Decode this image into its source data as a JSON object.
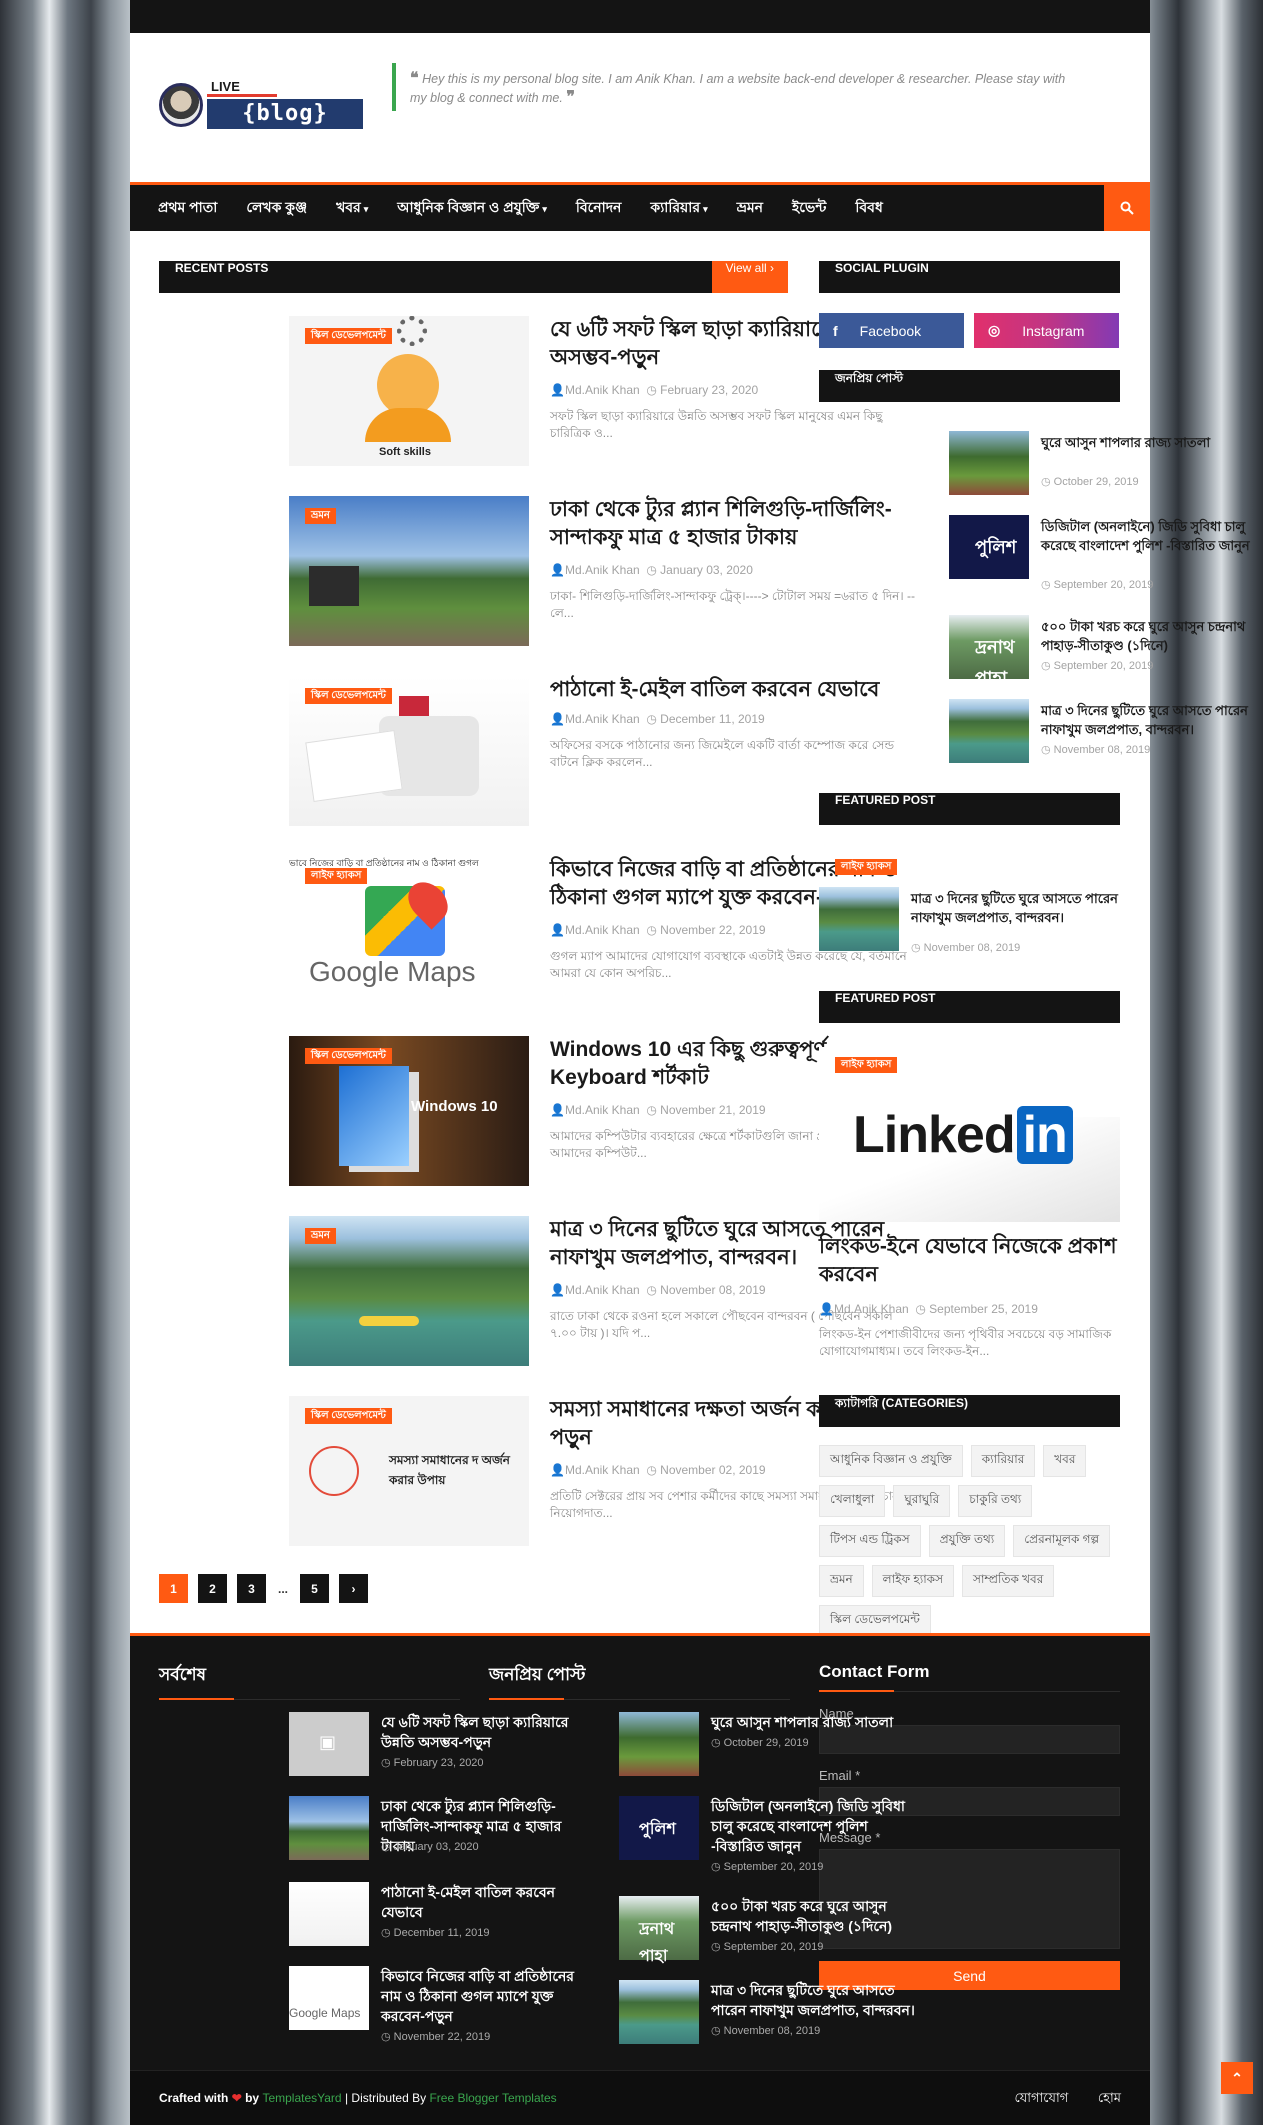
{
  "header": {
    "logo_live": "LIVE",
    "logo_blog": "{blog}",
    "quote": "Hey this is my personal blog site. I am Anik Khan. I am a website back-end developer & researcher. Please stay with my blog & connect with me."
  },
  "nav": {
    "items": [
      {
        "label": "প্রথম পাতা",
        "dropdown": false
      },
      {
        "label": "লেখক কুঞ্জ",
        "dropdown": false
      },
      {
        "label": "খবর",
        "dropdown": true
      },
      {
        "label": "আধুনিক বিজ্ঞান ও প্রযুক্তি",
        "dropdown": true
      },
      {
        "label": "বিনোদন",
        "dropdown": false
      },
      {
        "label": "ক্যারিয়ার",
        "dropdown": true
      },
      {
        "label": "ভ্রমন",
        "dropdown": false
      },
      {
        "label": "ইভেন্ট",
        "dropdown": false
      },
      {
        "label": "বিবধ",
        "dropdown": false
      }
    ]
  },
  "recent": {
    "title": "RECENT POSTS",
    "view_all": "View all",
    "posts": [
      {
        "badge": "স্কিল ডেভেলপমেন্ট",
        "title": "যে ৬টি সফট স্কিল ছাড়া ক্যারিয়ারে উন্নতি অসম্ভব-পড়ুন",
        "author": "Md.Anik Khan",
        "date": "February 23, 2020",
        "excerpt": "সফট স্কিল ছাড়া ক্যারিয়ারে উন্নতি অসম্ভব সফট স্কিল মানুষের এমন কিছু চারিত্রিক ও...",
        "img_text": "Soft skills"
      },
      {
        "badge": "ভ্রমন",
        "title": "ঢাকা থেকে ট্যুর প্ল্যান শিলিগুড়ি-দার্জিলিং-সান্দাকফু মাত্র ৫ হাজার টাকায়",
        "author": "Md.Anik Khan",
        "date": "January 03, 2020",
        "excerpt": "ঢাকা- শিলিগুড়ি-দার্জিলিং-সান্দাকফু ট্রেক্‌।----> টোটাল সময় =৬রাত ৫ দিন। --লে..."
      },
      {
        "badge": "স্কিল ডেভেলপমেন্ট",
        "title": "পাঠানো ই-মেইল বাতিল করবেন যেভাবে",
        "author": "Md.Anik Khan",
        "date": "December 11, 2019",
        "excerpt": "অফিসের বসকে পাঠানোর জন্য জিমেইলে একটি বার্তা কম্পোজ করে সেন্ড বাটনে ক্লিক করলেন..."
      },
      {
        "badge": "লাইফ হ্যাকস",
        "title": "কিভাবে নিজের বাড়ি বা প্রতিষ্ঠানের নাম ও ঠিকানা গুগল ম্যাপে যুক্ত করবেন-পড়ুন",
        "author": "Md.Anik Khan",
        "date": "November 22, 2019",
        "excerpt": "গুগল ম্যাপ আমাদের যোগাযোগ ব্যবস্থাকে এতটাই উন্নত করেছে যে, বর্তমানে আমরা যে কোন অপরিচ...",
        "img_caption": "ভাবে নিজের বাড়ি বা প্রতিষ্ঠানের নাম ও ঠিকানা গুগল",
        "img_text": "Google Maps"
      },
      {
        "badge": "স্কিল ডেভেলপমেন্ট",
        "title": "Windows 10 এর কিছু গুরুত্বপূর্ণ Keyboard শর্টকাট",
        "author": "Md.Anik Khan",
        "date": "November 21, 2019",
        "excerpt": "আমাদের কম্পিউটার ব্যবহারের ক্ষেত্রে শর্টকাটগুলি জানা প্রয়োজন এতে করে আমাদের কম্পিউট...",
        "img_text": "Windows 10"
      },
      {
        "badge": "ভ্রমন",
        "title": "মাত্র ৩ দিনের ছুটিতে ঘুরে আসতে পারেন নাফাখুম জলপ্রপাত, বান্দরবন।",
        "author": "Md.Anik Khan",
        "date": "November 08, 2019",
        "excerpt": "রাতে ঢাকা থেকে রওনা হলে সকালে পৌছবেন বান্দরবন ( পৌছবেন সকাল ৭.০০ টায় )। যদি প..."
      },
      {
        "badge": "স্কিল ডেভেলপমেন্ট",
        "title": "সমস্যা সমাধানের দক্ষতা অর্জন করার উপায়-পড়ুন",
        "author": "Md.Anik Khan",
        "date": "November 02, 2019",
        "excerpt": "প্রতিটি সেক্টরের প্রায় সব পেশার কর্মীদের কাছে সমস্যা সমাধানের দক্ষতা চান নিয়োগদাত...",
        "img_text": "সমস্যা সমাধানের দ অর্জন করার উপায়"
      }
    ]
  },
  "pager": {
    "items": [
      "1",
      "2",
      "3",
      "...",
      "5",
      "›"
    ]
  },
  "side": {
    "social_title": "SOCIAL PLUGIN",
    "facebook": "Facebook",
    "instagram": "Instagram",
    "popular_title": "জনপ্রিয় পোস্ট",
    "popular": [
      {
        "title": "ঘুরে আসুন শাপলার রাজ্য সাতলা",
        "date": "October 29, 2019"
      },
      {
        "title": "ডিজিটাল (অনলাইনে) জিডি সুবিধা চালু করেছে বাংলাদেশ পুলিশ -বিস্তারিত জানুন",
        "date": "September 20, 2019",
        "img_text": "পুলিশ"
      },
      {
        "title": "৫০০ টাকা খরচ করে ঘুরে আসুন চন্দ্রনাথ পাহাড়-সীতাকুণ্ড (১দিনে)",
        "date": "September 20, 2019",
        "img_text": "দ্রনাথ পাহা"
      },
      {
        "title": "মাত্র ৩ দিনের ছুটিতে ঘুরে আসতে পারেন নাফাখুম জলপ্রপাত, বান্দরবন।",
        "date": "November 08, 2019"
      }
    ],
    "featured_title": "FEATURED POST",
    "featured1": {
      "badge": "লাইফ হ্যাকস",
      "title": "মাত্র ৩ দিনের ছুটিতে ঘুরে আসতে পারেন নাফাখুম জলপ্রপাত, বান্দরবন।",
      "date": "November 08, 2019"
    },
    "featured2_title": "FEATURED POST",
    "featured2": {
      "badge": "লাইফ হ্যাকস",
      "img_text_a": "Linked",
      "img_text_b": "in",
      "title": "লিংকড-ইনে যেভাবে নিজেকে প্রকাশ করবেন",
      "author": "Md.Anik Khan",
      "date": "September 25, 2019",
      "excerpt": "লিংকড-ইন পেশাজীবীদের জন্য পৃথিবীর সবচেয়ে বড় সামাজিক যোগাযোগমাধ্যম। তবে লিংকড-ইন..."
    },
    "categories_title": "ক্যাটাগরি (CATEGORIES)",
    "categories": [
      "আধুনিক বিজ্ঞান ও প্রযুক্তি",
      "ক্যারিয়ার",
      "খবর",
      "খেলাধুলা",
      "ঘুরাঘুরি",
      "চাকুরি তথ্য",
      "টিপস এন্ড ট্রিকস",
      "প্রযুক্তি তথ্য",
      "প্রেরনামূলক গল্প",
      "ভ্রমন",
      "লাইফ হ্যাকস",
      "সাম্প্রতিক খবর",
      "স্কিল ডেভেলপমেন্ট"
    ]
  },
  "footer": {
    "latest_title": "সর্বশেষ",
    "latest": [
      {
        "title": "যে ৬টি সফট স্কিল ছাড়া ক্যারিয়ারে উন্নতি অসম্ভব-পড়ুন",
        "date": "February 23, 2020"
      },
      {
        "title": "ঢাকা থেকে ট্যুর প্ল্যান শিলিগুড়ি-দার্জিলিং-সান্দাকফু মাত্র ৫ হাজার টাকায়",
        "date": "January 03, 2020"
      },
      {
        "title": "পাঠানো ই-মেইল বাতিল করবেন যেভাবে",
        "date": "December 11, 2019"
      },
      {
        "title": "কিভাবে নিজের বাড়ি বা প্রতিষ্ঠানের নাম ও ঠিকানা গুগল ম্যাপে যুক্ত করবেন-পড়ুন",
        "date": "November 22, 2019",
        "img_text": "Google Maps"
      }
    ],
    "popular_title": "জনপ্রিয় পোস্ট",
    "popular": [
      {
        "title": "ঘুরে আসুন শাপলার রাজ্য সাতলা",
        "date": "October 29, 2019"
      },
      {
        "title": "ডিজিটাল (অনলাইনে) জিডি সুবিধা চালু করেছে বাংলাদেশ পুলিশ -বিস্তারিত জানুন",
        "date": "September 20, 2019",
        "img_text": "পুলিশ"
      },
      {
        "title": "৫০০ টাকা খরচ করে ঘুরে আসুন চন্দ্রনাথ পাহাড়-সীতাকুণ্ড (১দিনে)",
        "date": "September 20, 2019",
        "img_text": "দ্রনাথ পাহা"
      },
      {
        "title": "মাত্র ৩ দিনের ছুটিতে ঘুরে আসতে পারেন নাফাখুম জলপ্রপাত, বান্দরবন।",
        "date": "November 08, 2019"
      }
    ],
    "contact_title": "Contact Form",
    "name_label": "Name",
    "email_label": "Email *",
    "message_label": "Message *",
    "send_label": "Send"
  },
  "copyright": {
    "crafted": "Crafted with",
    "by": "by",
    "templatesyard": "TemplatesYard",
    "distributed": "| Distributed By",
    "fbt": "Free Blogger Templates",
    "link1": "যোগাযোগ",
    "link2": "হোম"
  },
  "colors": {
    "accent": "#ff5a12",
    "dark": "#141414",
    "facebook": "#3b5998",
    "quote_bar": "#3aa64e"
  }
}
